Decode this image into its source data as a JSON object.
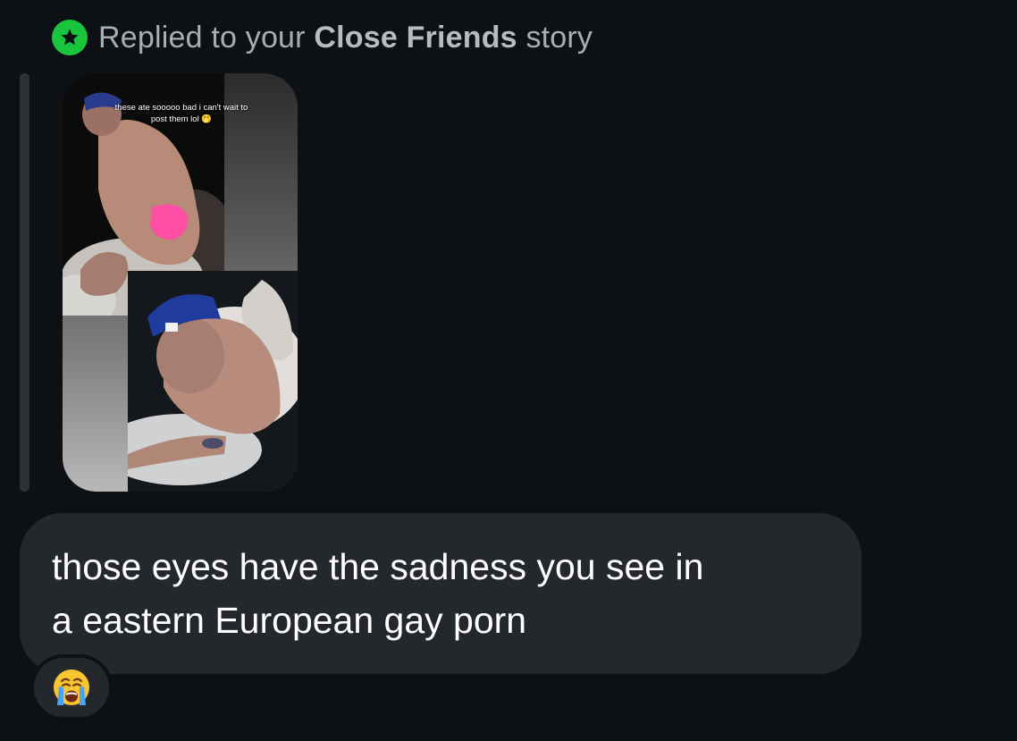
{
  "reply_header": {
    "prefix": "Replied to your",
    "emphasis": "Close Friends",
    "suffix": "story",
    "badge_icon": "star-icon",
    "badge_color": "#18c53c"
  },
  "story": {
    "caption_line1": "these ate sooooo bad i can't wait to",
    "caption_line2": "post them lol 🤭",
    "photo_top_icon": "photo-thumbnail",
    "photo_bottom_icon": "photo-thumbnail"
  },
  "message": {
    "line1": "those eyes have the sadness you see in",
    "line2": "a eastern European gay porn"
  },
  "reaction": {
    "emoji": "😭",
    "icon": "loudly-crying-face-icon"
  },
  "colors": {
    "background": "#0d1116",
    "bubble": "#24282d",
    "text_primary": "#ffffff",
    "text_secondary": "#a8adb4"
  }
}
